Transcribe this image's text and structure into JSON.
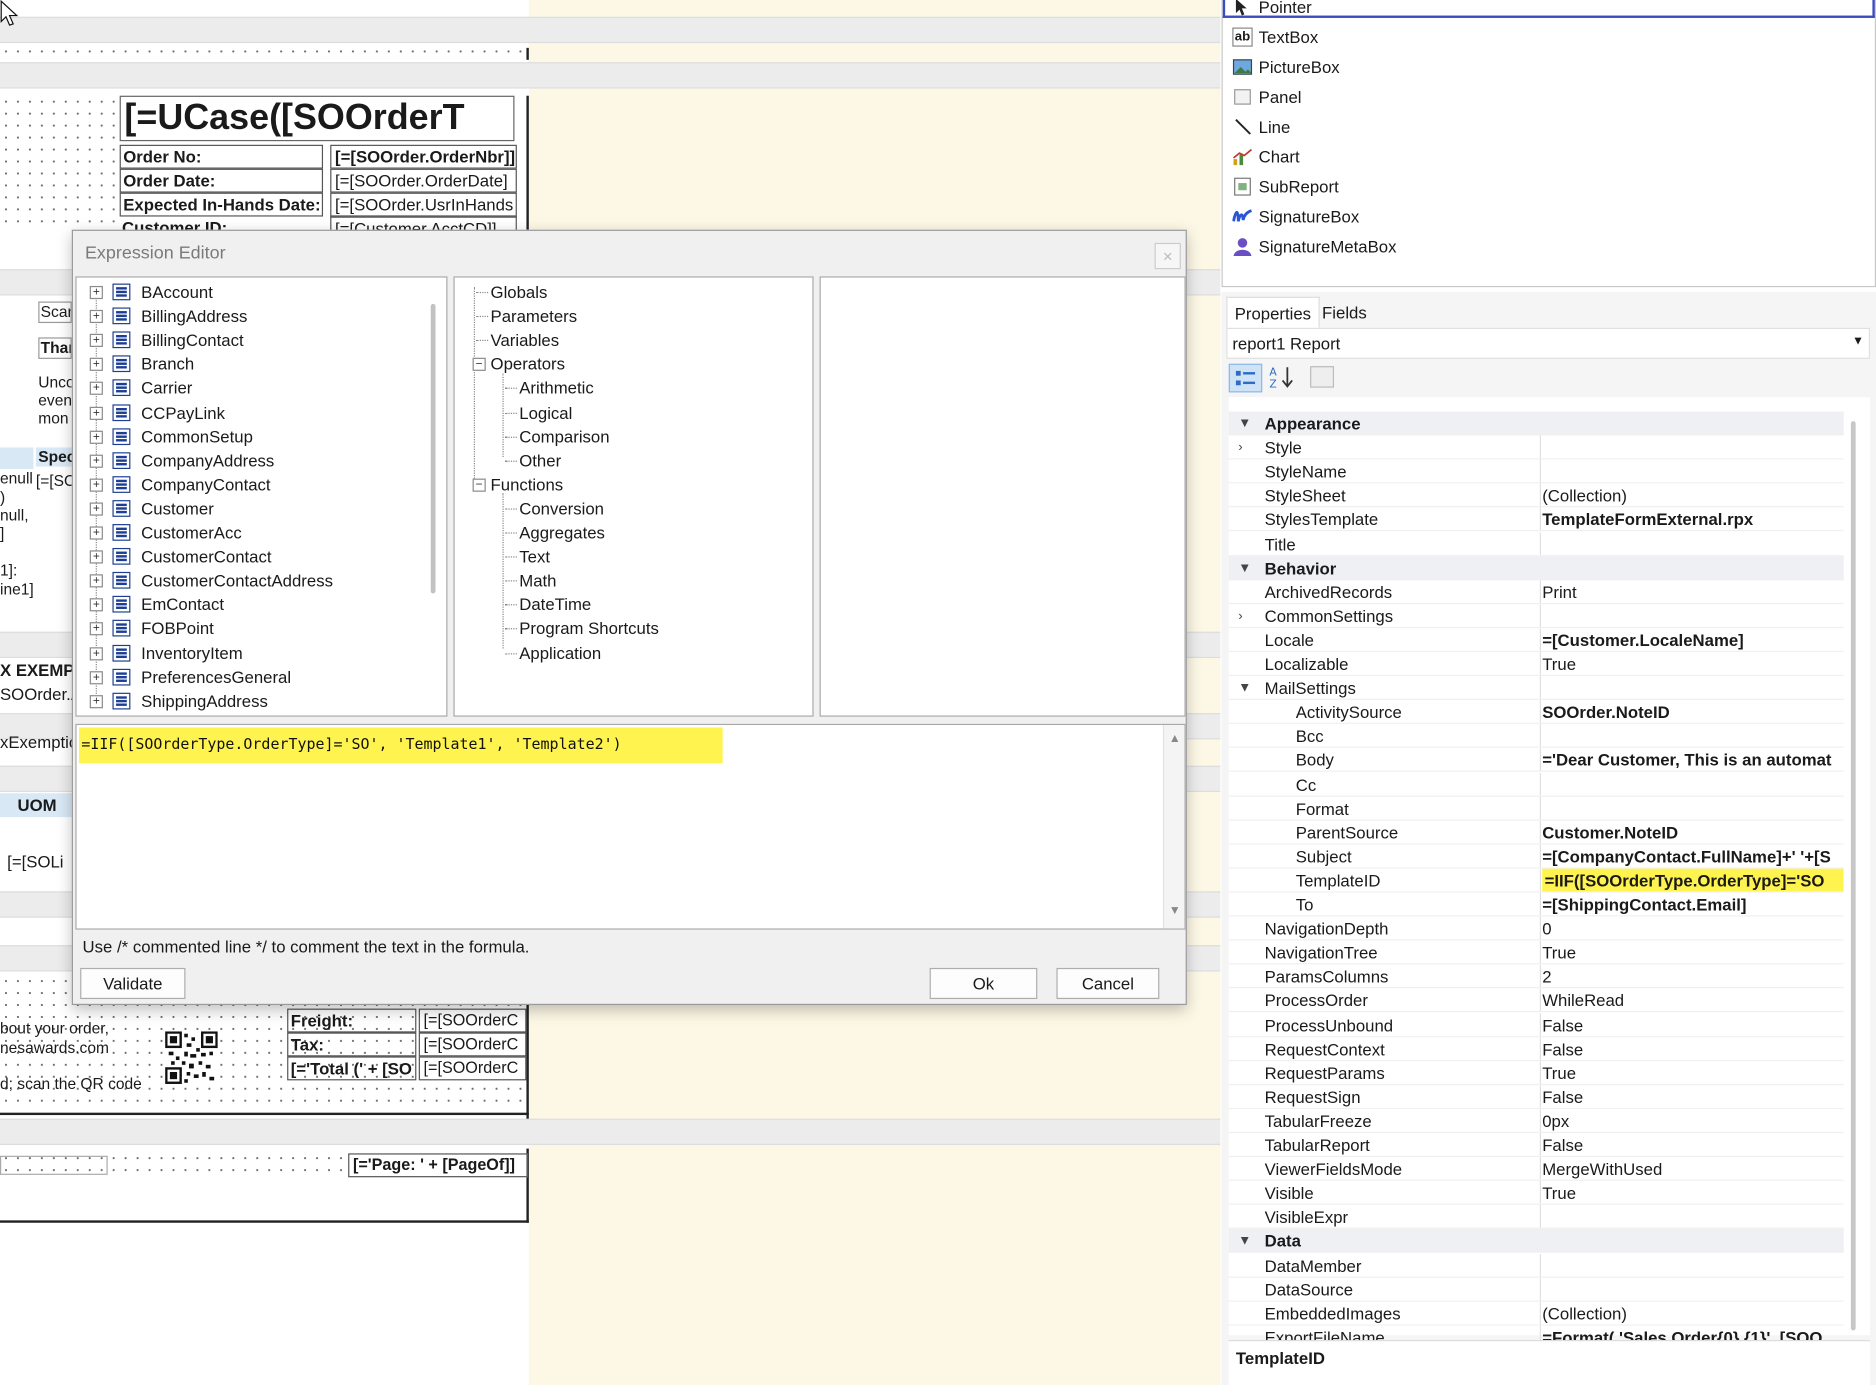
{
  "designer": {
    "title_field": "[=UCase([SOOrderT",
    "fields": [
      {
        "label": "Order No:",
        "value": "[=[SOOrder.OrderNbr]]"
      },
      {
        "label": "Order Date:",
        "value": "[=[SOOrder.OrderDate]"
      },
      {
        "label": "Expected In-Hands Date:",
        "value": "[=[SOOrder.UsrInHands"
      },
      {
        "label": "Customer ID:",
        "value": "[=[Customer.AcctCD]]"
      }
    ],
    "side_items": [
      "Scan",
      "Than",
      "Unco",
      "even",
      "mon",
      "Spec",
      "[=[SO",
      "enull,",
      ")",
      "null,",
      "]",
      "1]:",
      "ine1]",
      "X EXEMP",
      "SOOrder.A",
      "xExemptio",
      "UOM",
      "[=[SOLi"
    ],
    "footer_text": [
      "bout your order,",
      "nesawards.com",
      "d; scan the QR code"
    ],
    "totals": [
      {
        "label": "Freight:",
        "value": "[=[SOOrderC"
      },
      {
        "label": "Tax:",
        "value": "[=[SOOrderC"
      },
      {
        "label": "[='Total (' + [SO",
        "value": "[=[SOOrderC"
      }
    ],
    "page_field": "[='Page: ' + [PageOf]]"
  },
  "dialog": {
    "title": "Expression Editor",
    "close_label": "×",
    "tables": [
      "BAccount",
      "BillingAddress",
      "BillingContact",
      "Branch",
      "Carrier",
      "CCPayLink",
      "CommonSetup",
      "CompanyAddress",
      "CompanyContact",
      "Customer",
      "CustomerAcc",
      "CustomerContact",
      "CustomerContactAddress",
      "EmContact",
      "FOBPoint",
      "InventoryItem",
      "PreferencesGeneral",
      "ShippingAddress"
    ],
    "categories": {
      "top": [
        "Globals",
        "Parameters",
        "Variables"
      ],
      "operators": "Operators",
      "operator_items": [
        "Arithmetic",
        "Logical",
        "Comparison",
        "Other"
      ],
      "functions": "Functions",
      "function_items": [
        "Conversion",
        "Aggregates",
        "Text",
        "Math",
        "DateTime",
        "Program Shortcuts",
        "Application"
      ]
    },
    "expression": "=IIF([SOOrderType.OrderType]='SO', 'Template1', 'Template2')",
    "hint": "Use /* commented line */ to comment the text in the formula.",
    "validate_label": "Validate",
    "ok_label": "Ok",
    "cancel_label": "Cancel"
  },
  "toolbox": {
    "items": [
      {
        "label": "Pointer",
        "icon": "pointer-icon"
      },
      {
        "label": "TextBox",
        "icon": "textbox-icon"
      },
      {
        "label": "PictureBox",
        "icon": "picturebox-icon"
      },
      {
        "label": "Panel",
        "icon": "panel-icon"
      },
      {
        "label": "Line",
        "icon": "line-icon"
      },
      {
        "label": "Chart",
        "icon": "chart-icon"
      },
      {
        "label": "SubReport",
        "icon": "subreport-icon"
      },
      {
        "label": "SignatureBox",
        "icon": "signaturebox-icon"
      },
      {
        "label": "SignatureMetaBox",
        "icon": "signaturemetabox-icon"
      }
    ],
    "textbox_glyph": "ab"
  },
  "properties": {
    "tabs": [
      "Properties",
      "Fields"
    ],
    "selector": "report1 Report",
    "rows": [
      {
        "type": "cat",
        "name": "Appearance"
      },
      {
        "name": "Style",
        "value": "",
        "expand": true
      },
      {
        "name": "StyleName",
        "value": ""
      },
      {
        "name": "StyleSheet",
        "value": "(Collection)"
      },
      {
        "name": "StylesTemplate",
        "value": "TemplateFormExternal.rpx",
        "bold": true
      },
      {
        "name": "Title",
        "value": ""
      },
      {
        "type": "cat",
        "name": "Behavior"
      },
      {
        "name": "ArchivedRecords",
        "value": "Print"
      },
      {
        "name": "CommonSettings",
        "value": "",
        "expand": true
      },
      {
        "name": "Locale",
        "value": "=[Customer.LocaleName]",
        "bold": true
      },
      {
        "name": "Localizable",
        "value": "True"
      },
      {
        "name": "MailSettings",
        "value": "",
        "open": true
      },
      {
        "name": "ActivitySource",
        "value": "SOOrder.NoteID",
        "bold": true,
        "indent": true
      },
      {
        "name": "Bcc",
        "value": "",
        "indent": true
      },
      {
        "name": "Body",
        "value": "='Dear Customer, This is an automat",
        "bold": true,
        "indent": true
      },
      {
        "name": "Cc",
        "value": "",
        "indent": true
      },
      {
        "name": "Format",
        "value": "",
        "indent": true
      },
      {
        "name": "ParentSource",
        "value": "Customer.NoteID",
        "bold": true,
        "indent": true
      },
      {
        "name": "Subject",
        "value": "=[CompanyContact.FullName]+' '+[S",
        "bold": true,
        "indent": true
      },
      {
        "name": "TemplateID",
        "value": "=IIF([SOOrderType.OrderType]='SO",
        "bold": true,
        "indent": true,
        "highlight": true
      },
      {
        "name": "To",
        "value": "=[ShippingContact.Email]",
        "bold": true,
        "indent": true
      },
      {
        "name": "NavigationDepth",
        "value": "0"
      },
      {
        "name": "NavigationTree",
        "value": "True"
      },
      {
        "name": "ParamsColumns",
        "value": "2"
      },
      {
        "name": "ProcessOrder",
        "value": "WhileRead"
      },
      {
        "name": "ProcessUnbound",
        "value": "False"
      },
      {
        "name": "RequestContext",
        "value": "False"
      },
      {
        "name": "RequestParams",
        "value": "True"
      },
      {
        "name": "RequestSign",
        "value": "False"
      },
      {
        "name": "TabularFreeze",
        "value": "0px"
      },
      {
        "name": "TabularReport",
        "value": "False"
      },
      {
        "name": "ViewerFieldsMode",
        "value": "MergeWithUsed"
      },
      {
        "name": "Visible",
        "value": "True"
      },
      {
        "name": "VisibleExpr",
        "value": ""
      },
      {
        "type": "cat",
        "name": "Data"
      },
      {
        "name": "DataMember",
        "value": ""
      },
      {
        "name": "DataSource",
        "value": ""
      },
      {
        "name": "EmbeddedImages",
        "value": "(Collection)"
      },
      {
        "name": "ExportFileName",
        "value": "=Format( 'Sales Order{0} {1}', [SOO",
        "bold": true
      }
    ],
    "description_title": "TemplateID"
  },
  "colors": {
    "highlight": "#fff44f",
    "accent": "#1c3f95"
  }
}
